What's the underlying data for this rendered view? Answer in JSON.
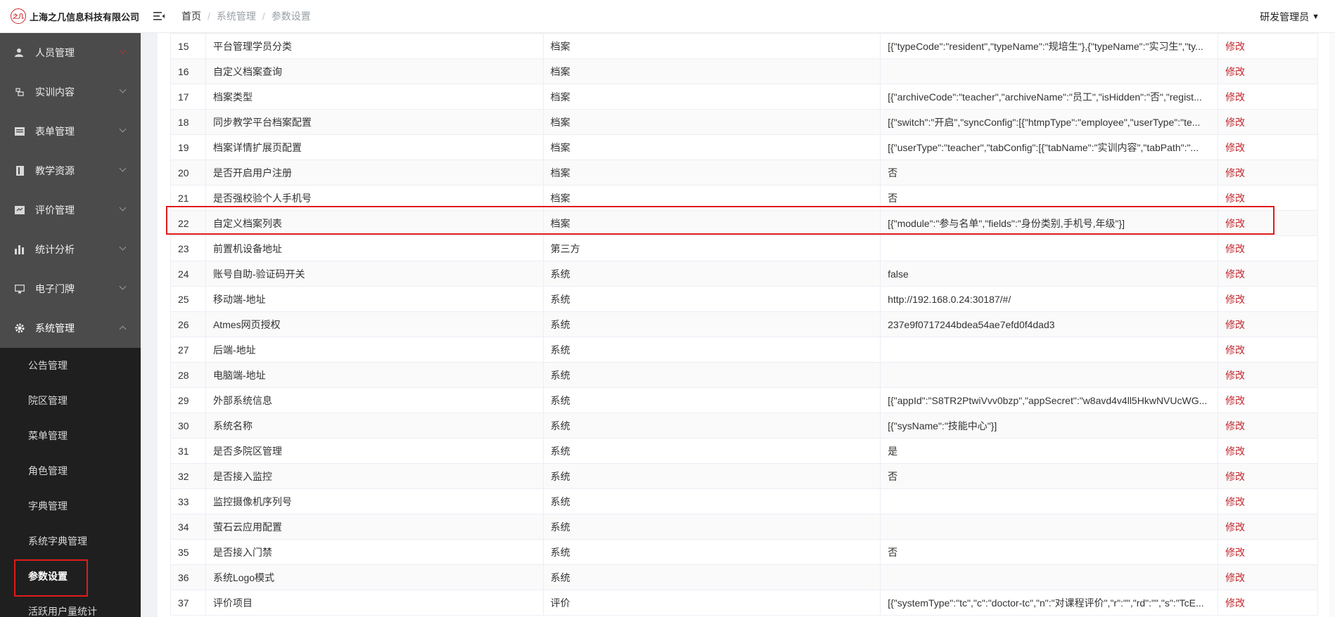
{
  "header": {
    "logo_mark": "之几",
    "company": "上海之几信息科技有限公司",
    "breadcrumb": [
      "首页",
      "系统管理",
      "参数设置"
    ],
    "user": "研发管理员"
  },
  "sidebar": {
    "items": [
      {
        "label": "人员管理",
        "icon": "user-icon"
      },
      {
        "label": "实训内容",
        "icon": "training-icon"
      },
      {
        "label": "表单管理",
        "icon": "form-icon"
      },
      {
        "label": "教学资源",
        "icon": "resource-icon"
      },
      {
        "label": "评价管理",
        "icon": "evaluation-icon"
      },
      {
        "label": "统计分析",
        "icon": "bar-chart-icon"
      },
      {
        "label": "电子门牌",
        "icon": "monitor-icon"
      },
      {
        "label": "系统管理",
        "icon": "gear-icon"
      }
    ],
    "submenu": [
      "公告管理",
      "院区管理",
      "菜单管理",
      "角色管理",
      "字典管理",
      "系统字典管理",
      "参数设置",
      "活跃用户量统计"
    ],
    "active_sub": "参数设置"
  },
  "table": {
    "edit_label": "修改",
    "highlight_no": 22,
    "rows": [
      {
        "no": "15",
        "name": "平台管理学员分类",
        "type": "档案",
        "value": "[{\"typeCode\":\"resident\",\"typeName\":\"规培生\"},{\"typeName\":\"实习生\",\"ty..."
      },
      {
        "no": "16",
        "name": "自定义档案查询",
        "type": "档案",
        "value": ""
      },
      {
        "no": "17",
        "name": "档案类型",
        "type": "档案",
        "value": "[{\"archiveCode\":\"teacher\",\"archiveName\":\"员工\",\"isHidden\":\"否\",\"regist..."
      },
      {
        "no": "18",
        "name": "同步教学平台档案配置",
        "type": "档案",
        "value": "[{\"switch\":\"开启\",\"syncConfig\":[{\"htmpType\":\"employee\",\"userType\":\"te..."
      },
      {
        "no": "19",
        "name": "档案详情扩展页配置",
        "type": "档案",
        "value": "[{\"userType\":\"teacher\",\"tabConfig\":[{\"tabName\":\"实训内容\",\"tabPath\":\"..."
      },
      {
        "no": "20",
        "name": "是否开启用户注册",
        "type": "档案",
        "value": "否"
      },
      {
        "no": "21",
        "name": "是否强校验个人手机号",
        "type": "档案",
        "value": "否"
      },
      {
        "no": "22",
        "name": "自定义档案列表",
        "type": "档案",
        "value": "[{\"module\":\"参与名单\",\"fields\":\"身份类别,手机号,年级\"}]"
      },
      {
        "no": "23",
        "name": "前置机设备地址",
        "type": "第三方",
        "value": ""
      },
      {
        "no": "24",
        "name": "账号自助-验证码开关",
        "type": "系统",
        "value": "false"
      },
      {
        "no": "25",
        "name": "移动端-地址",
        "type": "系统",
        "value": "http://192.168.0.24:30187/#/"
      },
      {
        "no": "26",
        "name": "Atmes网页授权",
        "type": "系统",
        "value": "237e9f0717244bdea54ae7efd0f4dad3"
      },
      {
        "no": "27",
        "name": "后端-地址",
        "type": "系统",
        "value": ""
      },
      {
        "no": "28",
        "name": "电脑端-地址",
        "type": "系统",
        "value": ""
      },
      {
        "no": "29",
        "name": "外部系统信息",
        "type": "系统",
        "value": "[{\"appId\":\"S8TR2PtwiVvv0bzp\",\"appSecret\":\"w8avd4v4ll5HkwNVUcWG..."
      },
      {
        "no": "30",
        "name": "系统名称",
        "type": "系统",
        "value": "[{\"sysName\":\"技能中心\"}]"
      },
      {
        "no": "31",
        "name": "是否多院区管理",
        "type": "系统",
        "value": "是"
      },
      {
        "no": "32",
        "name": "是否接入监控",
        "type": "系统",
        "value": "否"
      },
      {
        "no": "33",
        "name": "监控摄像机序列号",
        "type": "系统",
        "value": ""
      },
      {
        "no": "34",
        "name": "萤石云应用配置",
        "type": "系统",
        "value": ""
      },
      {
        "no": "35",
        "name": "是否接入门禁",
        "type": "系统",
        "value": "否"
      },
      {
        "no": "36",
        "name": "系统Logo模式",
        "type": "系统",
        "value": ""
      },
      {
        "no": "37",
        "name": "评价项目",
        "type": "评价",
        "value": "[{\"systemType\":\"tc\",\"c\":\"doctor-tc\",\"n\":\"对课程评价\",\"r\":\"\",\"rd\":\"\",\"s\":\"TcE..."
      }
    ]
  },
  "colors": {
    "sidebar": "#4b4b4b",
    "submenu": "#1f1f1f",
    "edit": "#c0272d",
    "highlight": "#e21a1a"
  }
}
